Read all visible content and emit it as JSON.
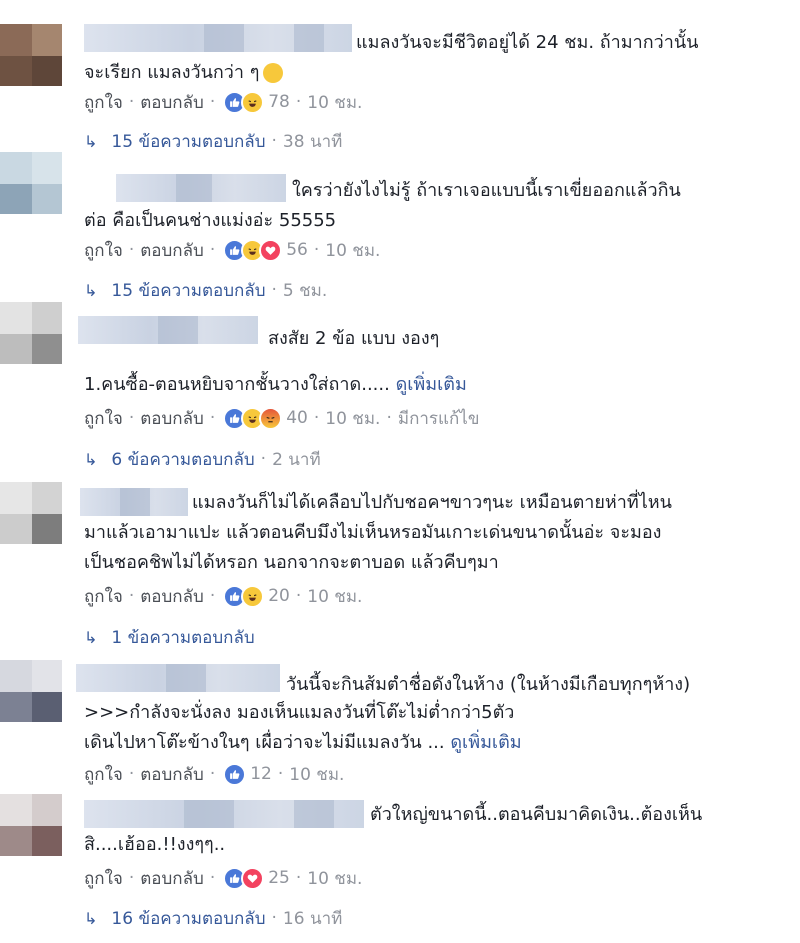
{
  "actions": {
    "like": "ถูกใจ",
    "reply": "ตอบกลับ",
    "sep": "·"
  },
  "comments": [
    {
      "lines": [
        "แมลงวันจะมีชีวิตอยู่ได้ 24 ชม. ถ้ามากว่านั้น",
        "จะเรียก แมลงวันกว่า ๆ"
      ],
      "reaction_icons": [
        "like-icon",
        "haha-icon"
      ],
      "reaction_count": "78",
      "time": "10 ชม.",
      "replies": "15 ข้อความตอบกลับ",
      "reply_time": "38 นาที"
    },
    {
      "lines": [
        "ใครว่ายังไงไม่รู้ ถ้าเราเจอแบบนี้เราเขี่ยออกแล้วกิน",
        "ต่อ คือเป็นคนช่างแม่งอ่ะ 55555"
      ],
      "reaction_icons": [
        "like-icon",
        "haha-icon",
        "love-icon"
      ],
      "reaction_count": "56",
      "time": "10 ชม.",
      "replies": "15 ข้อความตอบกลับ",
      "reply_time": "5 ชม."
    },
    {
      "lines": [
        "สงสัย 2 ข้อ แบบ งองๆ",
        "1.คนซื้อ-ตอนหยิบจากชั้นวางใส่ถาด....."
      ],
      "see_more": "ดูเพิ่มเติม",
      "reaction_icons": [
        "like-icon",
        "haha-icon",
        "angry-icon"
      ],
      "reaction_count": "40",
      "time": "10 ชม.",
      "edited": "มีการแก้ไข",
      "replies": "6 ข้อความตอบกลับ",
      "reply_time": "2 นาที"
    },
    {
      "lines": [
        "แมลงวันก็ไม่ได้เคลือบไปกับชอคฯขาวๆนะ เหมือนตายห่าที่ไหน",
        "มาแล้วเอามาแปะ แล้วตอนคีบมึงไม่เห็นหรอมันเกาะเด่นขนาดนั้นอ่ะ จะมอง",
        "เป็นชอคชิพไม่ได้หรอก นอกจากจะตาบอด แล้วคีบๆมา"
      ],
      "reaction_icons": [
        "like-icon",
        "haha-icon"
      ],
      "reaction_count": "20",
      "time": "10 ชม.",
      "replies": "1 ข้อความตอบกลับ"
    },
    {
      "lines": [
        "วันนี้จะกินส้มตำชื่อดังในห้าง (ในห้างมีเกือบทุกๆห้าง)",
        ">>>กำลังจะนั่งลง มองเห็นแมลงวันที่โต๊ะไม่ต่ำกว่า5ตัว",
        "เดินไปหาโต๊ะข้างในๆ เผื่อว่าจะไม่มีแมลงวัน ..."
      ],
      "see_more": "ดูเพิ่มเติม",
      "reaction_icons": [
        "like-icon"
      ],
      "reaction_count": "12",
      "time": "10 ชม."
    },
    {
      "lines": [
        "ตัวใหญ่ขนาดนี้..ตอนคีบมาคิดเงิน..ต้องเห็น",
        "สิ....เฮ้ออ.!!งงๆๆ.."
      ],
      "reaction_icons": [
        "like-icon",
        "love-icon"
      ],
      "reaction_count": "25",
      "time": "10 ชม.",
      "replies": "16 ข้อความตอบกลับ",
      "reply_time": "16 นาที"
    }
  ],
  "colors": {
    "link": "#365899",
    "meta": "#90949c",
    "text": "#1d2129",
    "like": "#4a78d8",
    "haha": "#f7c83b",
    "love": "#f3425f"
  }
}
